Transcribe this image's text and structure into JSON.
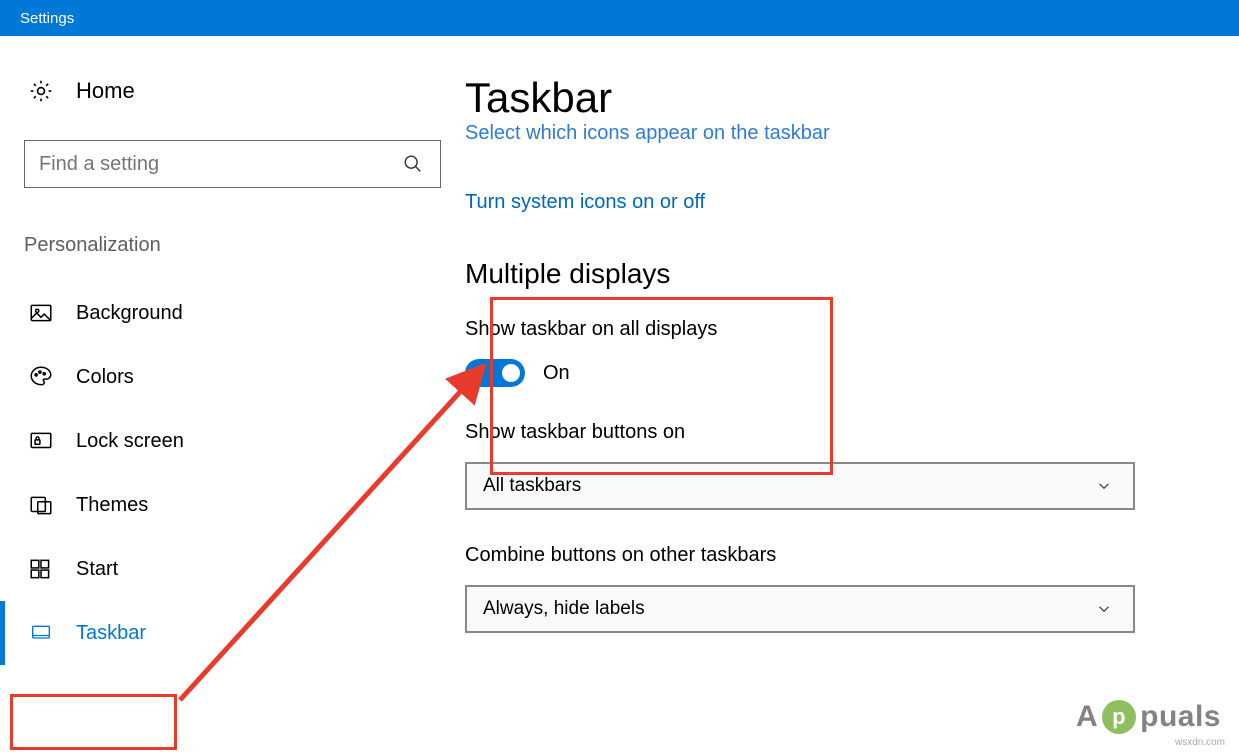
{
  "titlebar": {
    "title": "Settings"
  },
  "sidebar": {
    "home": "Home",
    "search_placeholder": "Find a setting",
    "section": "Personalization",
    "items": [
      {
        "label": "Background"
      },
      {
        "label": "Colors"
      },
      {
        "label": "Lock screen"
      },
      {
        "label": "Themes"
      },
      {
        "label": "Start"
      },
      {
        "label": "Taskbar"
      }
    ]
  },
  "main": {
    "title": "Taskbar",
    "link_cut": "Select which icons appear on the taskbar",
    "link_system": "Turn system icons on or off",
    "multiple_displays": {
      "heading": "Multiple displays",
      "show_taskbar_label": "Show taskbar on all displays",
      "toggle_state": "On",
      "show_buttons_label": "Show taskbar buttons on",
      "show_buttons_value": "All taskbars",
      "combine_label": "Combine buttons on other taskbars",
      "combine_value": "Always, hide labels"
    }
  },
  "watermark": {
    "prefix": "A",
    "badge": "p",
    "suffix": "puals",
    "site": "wsxdn.com"
  }
}
